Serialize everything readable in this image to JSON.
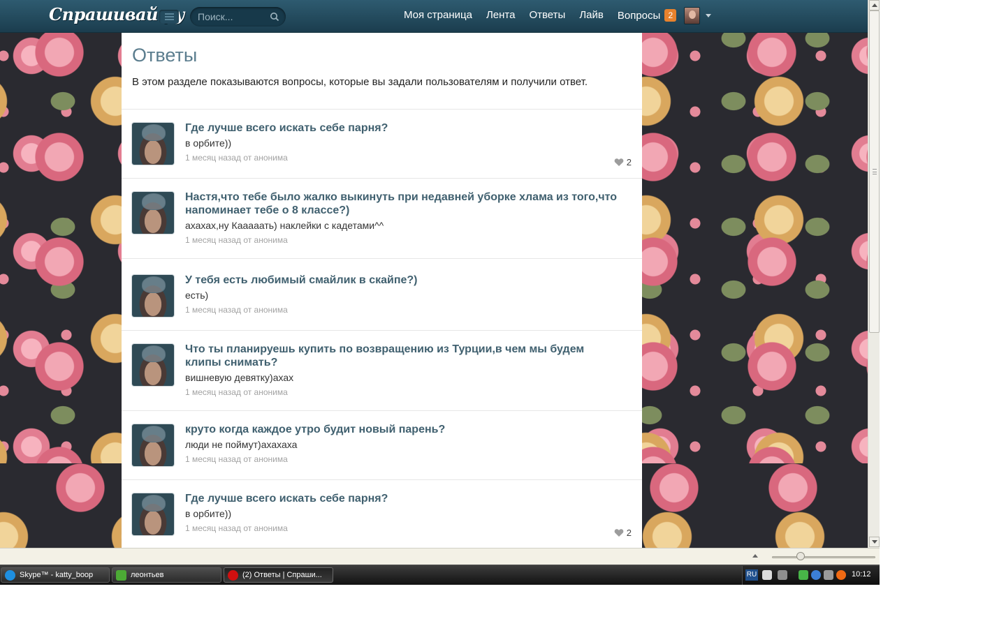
{
  "topbar": {
    "logo": "Спрашивай.ру",
    "search_placeholder": "Поиск...",
    "nav": {
      "my_page": "Моя страница",
      "feed": "Лента",
      "answers": "Ответы",
      "likes": "Лайв",
      "questions": "Вопросы",
      "questions_count": "2"
    }
  },
  "page": {
    "title": "Ответы",
    "description": "В этом разделе показываются вопросы, которые вы задали пользователям и получили ответ."
  },
  "items": [
    {
      "question": "Где лучше всего искать себе парня?",
      "answer": "в орбите))",
      "meta": "1 месяц назад от анонима",
      "likes": "2"
    },
    {
      "question": "Настя,что тебе было жалко выкинуть при недавней уборке хлама из того,что напоминает тебе о 8 классе?)",
      "answer": "ахахах,ну Кааааать) наклейки с кадетами^^",
      "meta": "1 месяц назад от анонима"
    },
    {
      "question": "У тебя есть любимый смайлик в скайпе?)",
      "answer": "есть)",
      "meta": "1 месяц назад от анонима"
    },
    {
      "question": "Что ты планируешь купить по возвращению из Турции,в чем мы будем клипы снимать?",
      "answer": "вишневую девятку)ахах",
      "meta": "1 месяц назад от анонима"
    },
    {
      "question": "круто когда каждое утро будит новый парень?",
      "answer": "люди не поймут)ахахаха",
      "meta": "1 месяц назад от анонима"
    },
    {
      "question": "Где лучше всего искать себе парня?",
      "answer": "в орбите))",
      "meta": "1 месяц назад от анонима",
      "likes": "2"
    }
  ],
  "taskbar": {
    "tasks": [
      "Skype™ - katty_boop",
      "леонтьев",
      "(2) Ответы | Спраши..."
    ],
    "lang": "RU",
    "clock": "10:12"
  },
  "colors": {
    "topbar": "#1b3d4e",
    "link": "#40606f",
    "title": "#5b7d8e",
    "badge": "#e7822d"
  },
  "icons": [
    "search-icon",
    "menu-icon",
    "heart-icon",
    "chevron-down-icon",
    "skype-icon",
    "opera-icon"
  ]
}
